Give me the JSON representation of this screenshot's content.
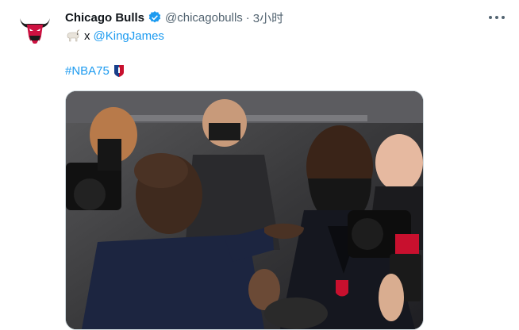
{
  "tweet": {
    "display_name": "Chicago Bulls",
    "handle": "@chicagobulls",
    "separator": "·",
    "time": "3小时",
    "line1_sep": "x",
    "mention": "@KingJames",
    "hashtag": "#NBA75"
  },
  "icons": {
    "avatar": "bulls-logo-icon",
    "verified": "verified-badge-icon",
    "more": "more-options-icon",
    "goat": "goat-emoji-icon",
    "nba75": "nba75-logo-icon"
  },
  "colors": {
    "link": "#1d9bf0",
    "secondary_text": "#536471",
    "bulls_red": "#ce1141"
  }
}
